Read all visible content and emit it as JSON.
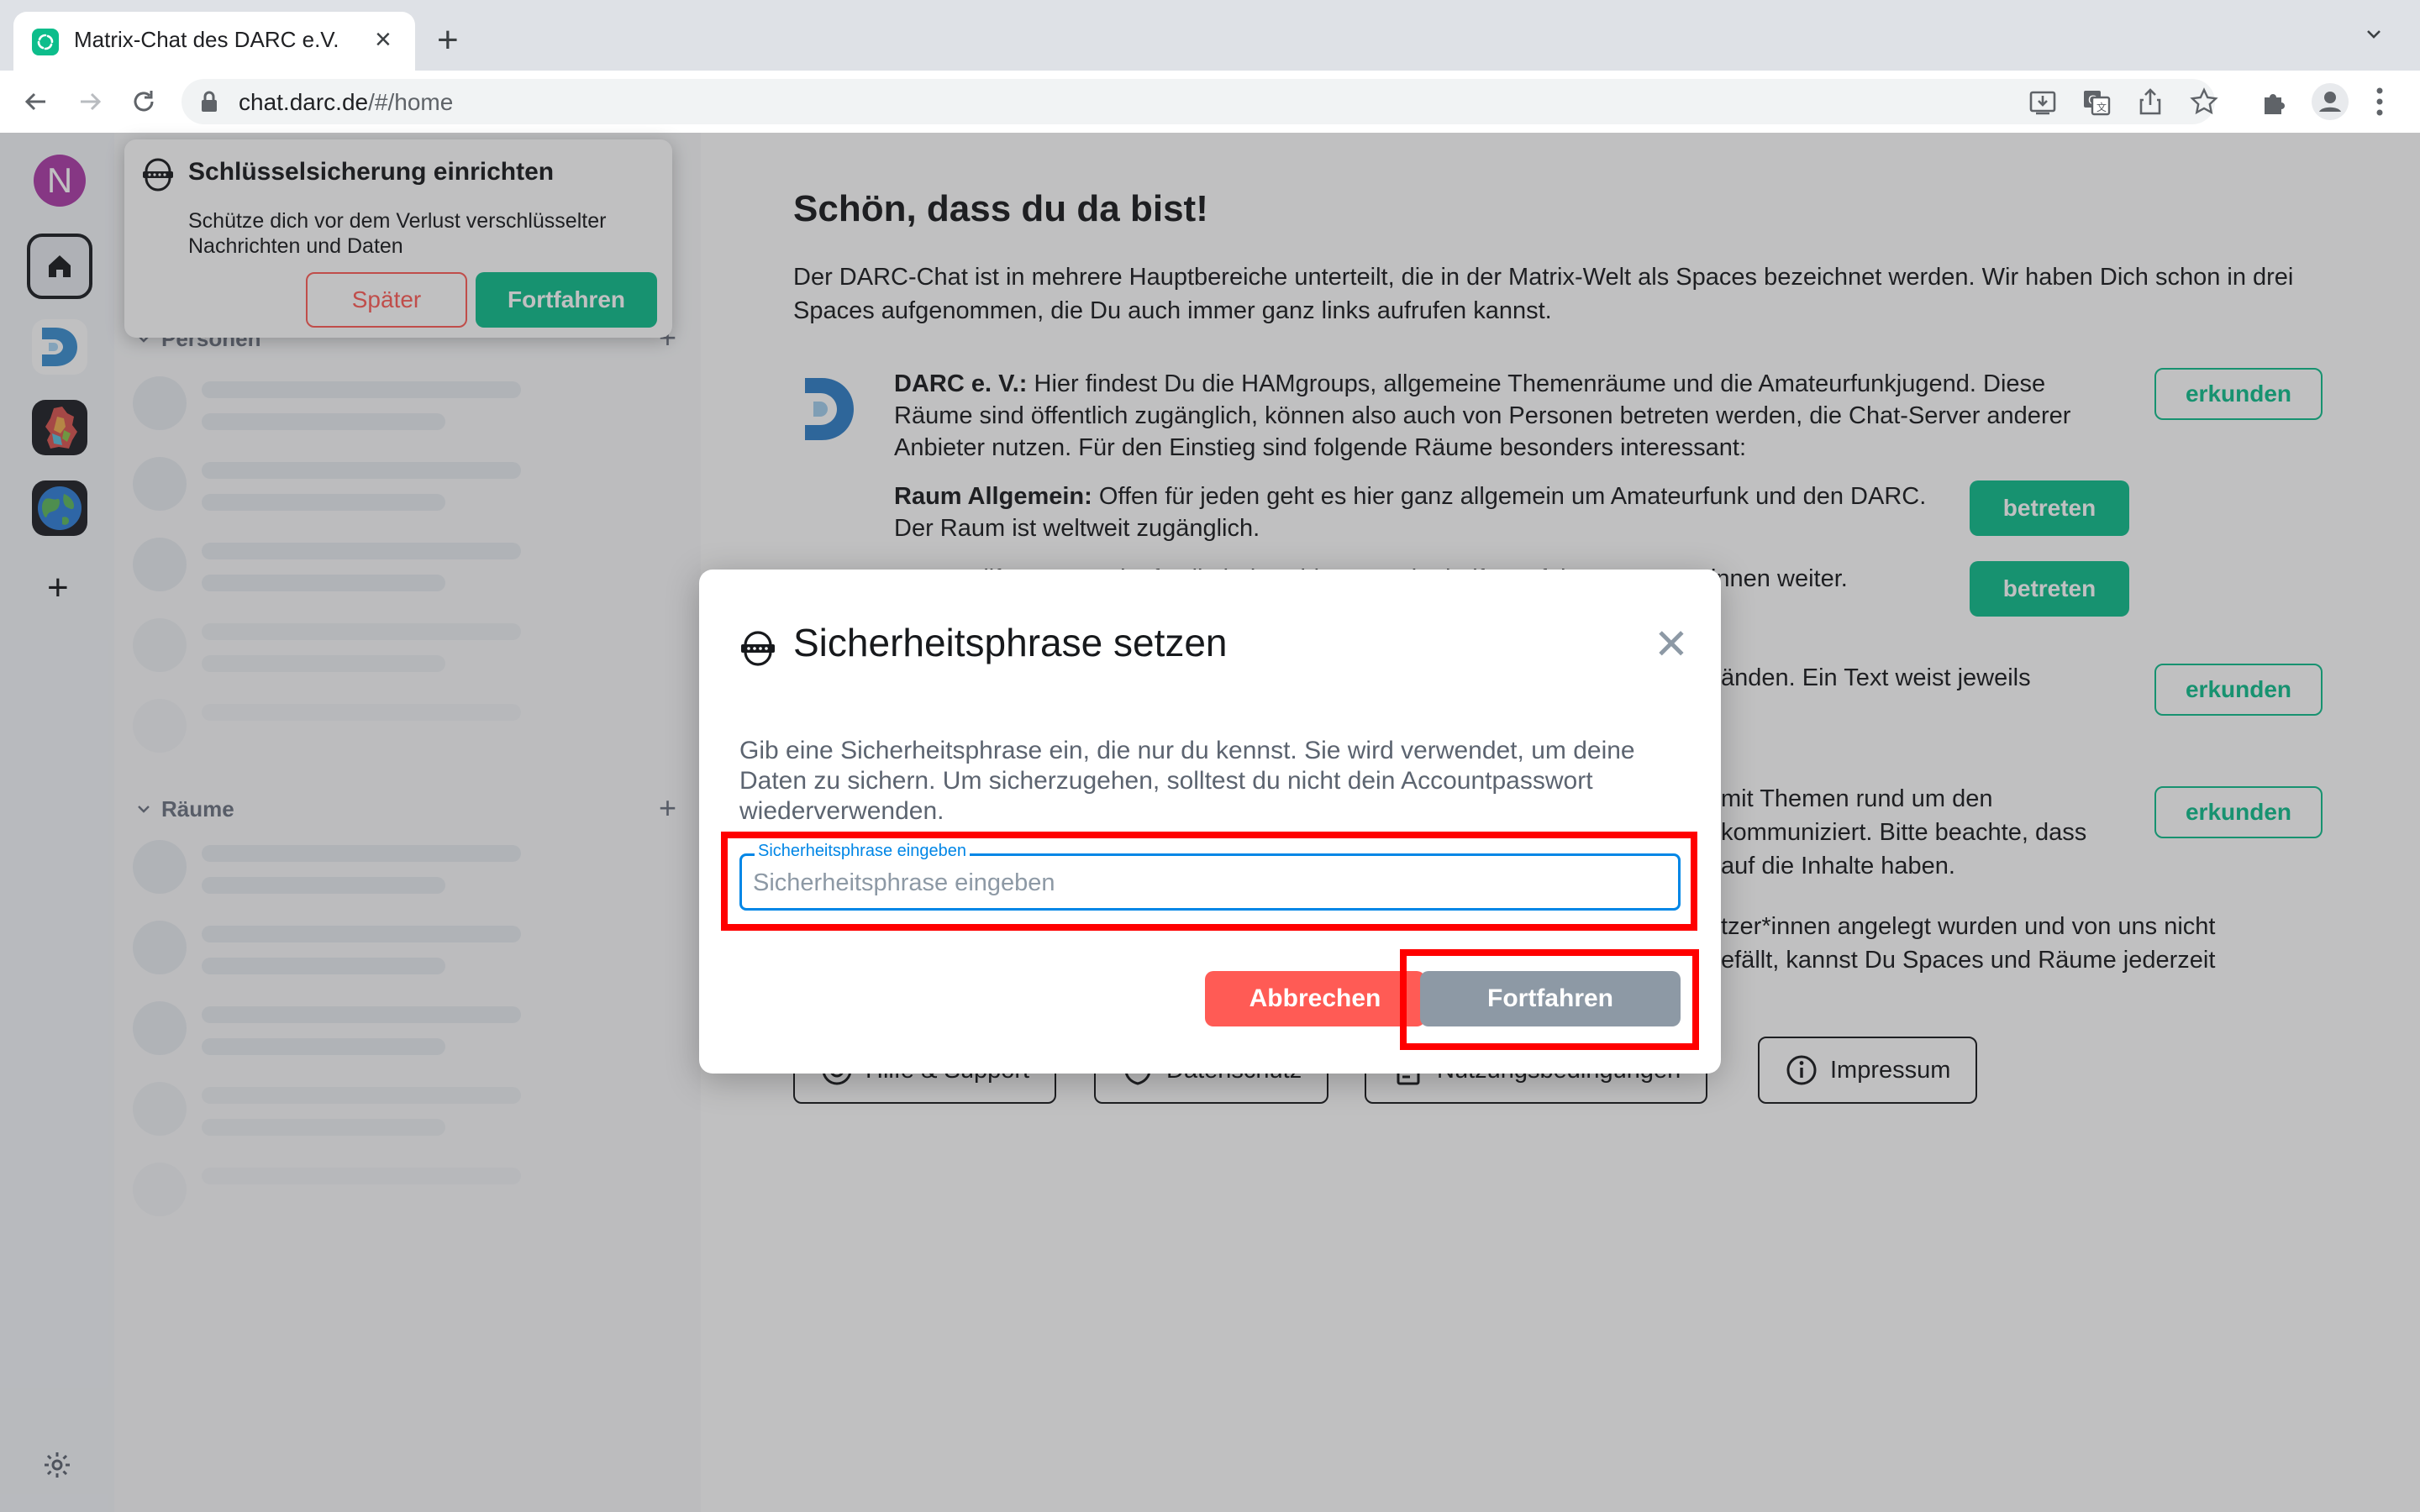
{
  "browser": {
    "tab_title": "Matrix-Chat des DARC e.V.",
    "url_host": "chat.darc.de",
    "url_path": "/#/home"
  },
  "sidebar": {
    "avatar_letter": "N",
    "sections": {
      "people": "Personen",
      "rooms": "Räume"
    }
  },
  "toast": {
    "title": "Schlüsselsicherung einrichten",
    "body": "Schütze dich vor dem Verlust verschlüsselter Nachrichten und Daten",
    "later_label": "Später",
    "continue_label": "Fortfahren"
  },
  "home": {
    "title": "Schön, dass du da bist!",
    "intro": "Der DARC-Chat ist in mehrere Hauptbereiche unterteilt, die in der Matrix-Welt als Spaces bezeichnet werden. Wir haben Dich schon in drei Spaces aufgenommen, die Du auch immer ganz links aufrufen kannst.",
    "darc_name": "DARC e. V.:",
    "darc_text": " Hier findest Du die HAMgroups, allgemeine Themenräume und die Amateurfunkjugend. Diese Räume sind öffentlich zugänglich, können also auch von Personen betreten werden, die Chat-Server anderer Anbieter nutzen. Für den Einstieg sind folgende Räume besonders interessant:",
    "room_allgemein_name": "Raum Allgemein:",
    "room_allgemein_text": " Offen für jeden geht es hier ganz allgemein um Amateurfunk und den DARC. Der Raum ist weltweit zugänglich.",
    "room_hilfe_partial": "Raum Hilfe: Erste Anlaufstelle bei Problemen. Hier helfen erfahrene Nutzer*innen weiter.",
    "text_2_partial": "änden. Ein Text weist jeweils",
    "text_3_partial_a": "mit Themen rund um den",
    "text_3_partial_b": "kommuniziert. Bitte beachte, dass",
    "text_3_partial_c": "auf die Inhalte haben.",
    "text_4_partial_a": "tzer*innen angelegt wurden und von uns nicht",
    "text_4_partial_b": "efällt, kannst Du Spaces und Räume jederzeit",
    "explore_label": "erkunden",
    "join_label": "betreten",
    "footer": {
      "help": "Hilfe & Support",
      "privacy": "Datenschutz",
      "terms": "Nutzungsbedingungen",
      "imprint": "Impressum"
    }
  },
  "dialog": {
    "title": "Sicherheitsphrase setzen",
    "body": "Gib eine Sicherheitsphrase ein, die nur du kennst. Sie wird verwendet, um deine Daten zu sichern. Um sicherzugehen, solltest du nicht dein Accountpasswort wiederverwenden.",
    "field_label": "Sicherheitsphrase eingeben",
    "field_placeholder": "Sicherheitsphrase eingeben",
    "field_value": "",
    "cancel_label": "Abbrechen",
    "continue_label": "Fortfahren"
  },
  "colors": {
    "accent_green": "#0dbd8b",
    "alert_red": "#ff5b55",
    "focus_blue": "#0086e6",
    "disabled_grey": "#8d99a5",
    "highlight_red": "#ff0000"
  }
}
